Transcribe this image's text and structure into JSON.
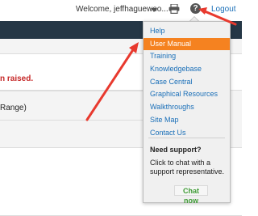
{
  "header": {
    "welcome_text": "Welcome, jeffhaguewoo...",
    "logout_label": "Logout",
    "help_glyph": "?"
  },
  "content": {
    "raised_text": "n raised.",
    "range_text": "Range)"
  },
  "help_menu": {
    "items": [
      {
        "label": "Help",
        "active": false
      },
      {
        "label": "User Manual",
        "active": true
      },
      {
        "label": "Training",
        "active": false
      },
      {
        "label": "Knowledgebase",
        "active": false
      },
      {
        "label": "Case Central",
        "active": false
      },
      {
        "label": "Graphical Resources",
        "active": false
      },
      {
        "label": "Walkthroughs",
        "active": false
      },
      {
        "label": "Site Map",
        "active": false
      },
      {
        "label": "Contact Us",
        "active": false
      }
    ],
    "support_title": "Need support?",
    "support_text": "Click to chat with a support representative.",
    "chat_label": "Chat now"
  },
  "icons": {
    "print": "printer-icon",
    "help": "help-question-icon",
    "dropdown": "caret-down-icon"
  },
  "colors": {
    "nav_band": "#253746",
    "highlight": "#f58220",
    "link": "#1a6fb8",
    "annotation": "#e8392e",
    "chat_text": "#3f9b36",
    "alert_text": "#c62828"
  }
}
